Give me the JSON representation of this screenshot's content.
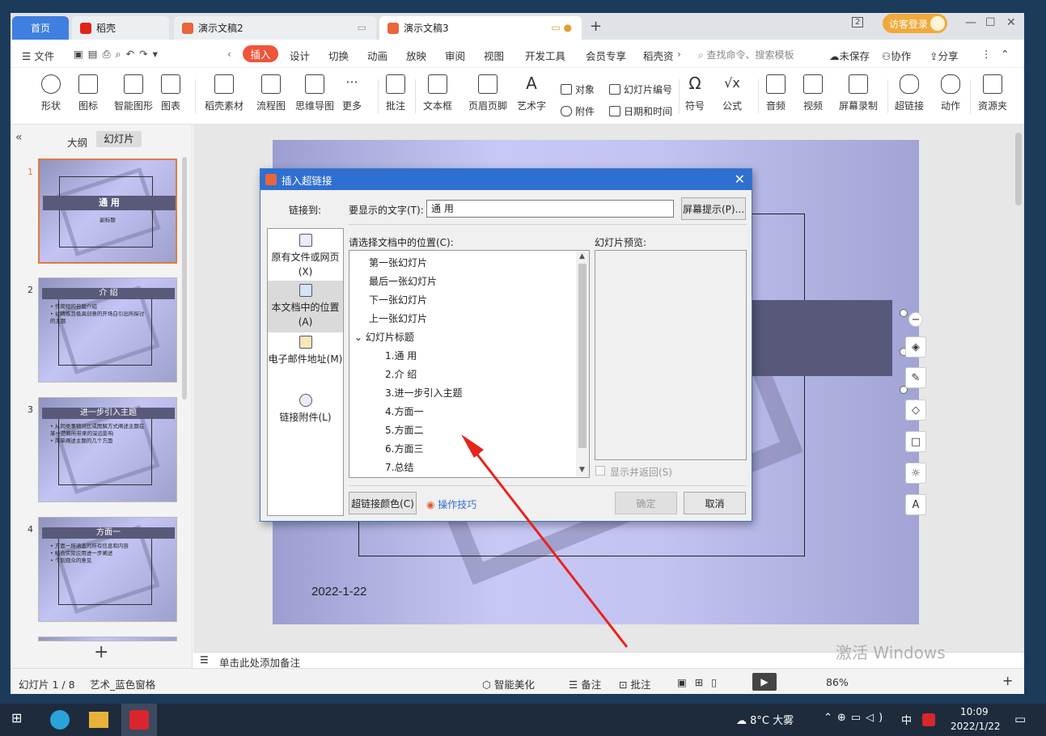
{
  "tabs": {
    "home": "首页",
    "daoke": "稻壳",
    "doc2": "演示文稿2",
    "doc3": "演示文稿3",
    "login": "访客登录"
  },
  "menu": {
    "file": "文件",
    "items": [
      "插入",
      "设计",
      "切换",
      "动画",
      "放映",
      "审阅",
      "视图",
      "开发工具",
      "会员专享",
      "稻壳资"
    ],
    "search": "查找命令、搜索模板",
    "unsaved": "未保存",
    "collab": "协作",
    "share": "分享"
  },
  "ribbon": {
    "items": [
      "形状",
      "图标",
      "智能图形",
      "图表",
      "稻壳素材",
      "流程图",
      "思维导图",
      "更多",
      "批注",
      "文本框",
      "页眉页脚",
      "艺术字",
      "符号",
      "公式",
      "音频",
      "视频",
      "屏幕录制",
      "超链接",
      "动作",
      "资源夹"
    ],
    "small": [
      "对象",
      "幻灯片编号",
      "附件",
      "日期和时间"
    ]
  },
  "panel": {
    "outline": "大纲",
    "slides": "幻灯片"
  },
  "thumbs": [
    {
      "num": "1",
      "title": "通  用",
      "sub": "副标题",
      "lines": []
    },
    {
      "num": "2",
      "title": "介  绍",
      "lines": [
        "• 作简短的自我介绍",
        "• 以精练且极具创意的开场白引出所探讨",
        "  的主题"
      ]
    },
    {
      "num": "3",
      "title": "进一步引入主题",
      "lines": [
        "• 从同类事物对比或图解方式阐述主题在",
        "  某一范畴所带来的深远影响",
        "• 简单阐述主题的几个方面"
      ]
    },
    {
      "num": "4",
      "title": "方面一",
      "lines": [
        "• 方面一所涵盖的所有信息和内容",
        "• 结合实际应用进一步阐述",
        "• 个别观众的意见"
      ]
    }
  ],
  "slide": {
    "date": "2022-1-22"
  },
  "notes": "单击此处添加备注",
  "status": {
    "slide": "幻灯片 1 / 8",
    "theme": "艺术_蓝色窗格",
    "beautify": "智能美化",
    "notes": "备注",
    "comment": "批注",
    "zoom": "86%"
  },
  "dialog": {
    "title": "插入超链接",
    "linkto": "链接到:",
    "display_label": "要显示的文字(T):",
    "display_value": "通  用",
    "screentip": "屏幕提示(P)...",
    "location_label": "请选择文档中的位置(C):",
    "preview_label": "幻灯片预览:",
    "linkto_items": [
      "原有文件或网页(X)",
      "本文档中的位置(A)",
      "电子邮件地址(M)",
      "链接附件(L)"
    ],
    "locations": [
      "第一张幻灯片",
      "最后一张幻灯片",
      "下一张幻灯片",
      "上一张幻灯片",
      "幻灯片标题",
      "1.通  用",
      "2.介  绍",
      "3.进一步引入主题",
      "4.方面一",
      "5.方面二",
      "6.方面三",
      "7.总结"
    ],
    "show_return": "显示并返回(S)",
    "color_btn": "超链接颜色(C)",
    "tips": "操作技巧",
    "ok": "确定",
    "cancel": "取消"
  },
  "watermark": "激活 Windows",
  "taskbar": {
    "weather": "8°C 大雾",
    "ime": "中",
    "time": "10:09",
    "date": "2022/1/22"
  },
  "colors": {
    "accent": "#f0543a",
    "dialog_title": "#2f6fd0",
    "tab_active": "#3f7fe0"
  }
}
